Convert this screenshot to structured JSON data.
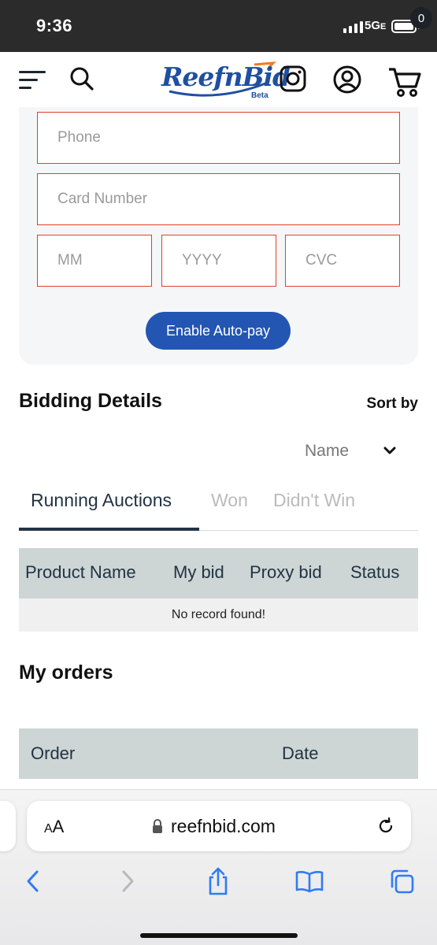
{
  "status_bar": {
    "time": "9:36",
    "network": "5G",
    "network_suffix": "E"
  },
  "header": {
    "logo_text": "ReefnBid",
    "logo_badge": "Beta",
    "cart_count": "0",
    "icons": [
      "menu-icon",
      "search-icon",
      "instagram-icon",
      "account-icon",
      "cart-icon"
    ]
  },
  "payment_form": {
    "phone_placeholder": "Phone",
    "card_number_placeholder": "Card Number",
    "month_placeholder": "MM",
    "year_placeholder": "YYYY",
    "cvc_placeholder": "CVC",
    "autopay_label": "Enable Auto-pay"
  },
  "bidding": {
    "title": "Bidding Details",
    "sort_label": "Sort by",
    "sort_value": "Name",
    "tabs": [
      {
        "label": "Running Auctions",
        "active": true
      },
      {
        "label": "Won",
        "active": false
      },
      {
        "label": "Didn't Win",
        "active": false
      }
    ],
    "columns": [
      "Product Name",
      "My bid",
      "Proxy bid",
      "Status"
    ],
    "empty_message": "No record found!"
  },
  "orders": {
    "title": "My orders",
    "columns": [
      "Order",
      "Date"
    ]
  },
  "browser": {
    "text_size_label": "AA",
    "url": "reefnbid.com",
    "toolbar_icons": [
      "back-icon",
      "forward-icon",
      "share-icon",
      "bookmarks-icon",
      "tabs-icon"
    ]
  },
  "colors": {
    "brand_blue": "#2356b3",
    "field_border": "#e0412a",
    "table_header": "#cdd5d5",
    "tab_active": "#223344"
  }
}
